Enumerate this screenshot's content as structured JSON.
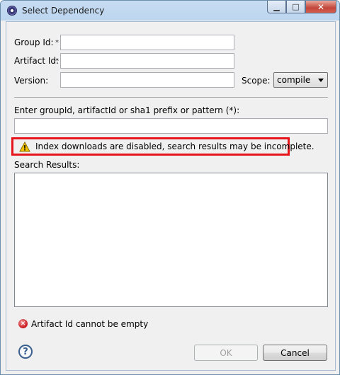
{
  "window": {
    "title": "Select Dependency",
    "controls": {
      "minimize": "▁",
      "maximize": "□",
      "close": "✕"
    }
  },
  "form": {
    "group_id_label": "Group Id:",
    "artifact_id_label": "Artifact Id:",
    "version_label": "Version:",
    "required_marker": "*",
    "group_id_value": "",
    "artifact_id_value": "",
    "version_value": "",
    "scope_label": "Scope:",
    "scope_value": "compile"
  },
  "search": {
    "prompt_label": "Enter groupId, artifactId or sha1 prefix or pattern (*):",
    "query_value": "",
    "warning_text": "Index downloads are disabled, search results may be incomplete.",
    "results_label": "Search Results:"
  },
  "status": {
    "error_text": "Artifact Id cannot be empty"
  },
  "buttons": {
    "help": "?",
    "ok": "OK",
    "cancel": "Cancel"
  },
  "icons": {
    "app": "eclipse-icon",
    "warning": "warning-icon",
    "error": "error-icon",
    "help": "help-icon"
  },
  "colors": {
    "highlight_border": "#e8141c",
    "error_icon": "#c8161c",
    "warning_icon": "#f5c400"
  }
}
